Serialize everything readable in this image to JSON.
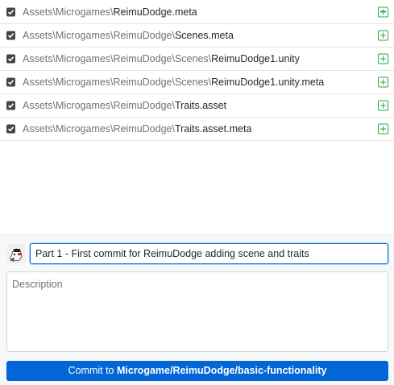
{
  "files": [
    {
      "dir": "Assets\\Microgames\\",
      "name": "ReimuDodge.meta",
      "checked": true,
      "status": "added"
    },
    {
      "dir": "Assets\\Microgames\\ReimuDodge\\",
      "name": "Scenes.meta",
      "checked": true,
      "status": "added"
    },
    {
      "dir": "Assets\\Microgames\\ReimuDodge\\Scenes\\",
      "name": "ReimuDodge1.unity",
      "checked": true,
      "status": "added"
    },
    {
      "dir": "Assets\\Microgames\\ReimuDodge\\Scenes\\",
      "name": "ReimuDodge1.unity.meta",
      "checked": true,
      "status": "added"
    },
    {
      "dir": "Assets\\Microgames\\ReimuDodge\\",
      "name": "Traits.asset",
      "checked": true,
      "status": "added"
    },
    {
      "dir": "Assets\\Microgames\\ReimuDodge\\",
      "name": "Traits.asset.meta",
      "checked": true,
      "status": "added"
    }
  ],
  "commit": {
    "summary_value": "Part 1 - First commit for ReimuDodge adding scene and traits",
    "description_placeholder": "Description",
    "button_prefix": "Commit to ",
    "branch": "Microgame/ReimuDodge/basic-functionality"
  },
  "colors": {
    "accent": "#0366d6",
    "added": "#28a745"
  },
  "icons": {
    "checkbox": "checkbox-checked-icon",
    "status": "file-added-icon",
    "avatar": "user-avatar"
  }
}
